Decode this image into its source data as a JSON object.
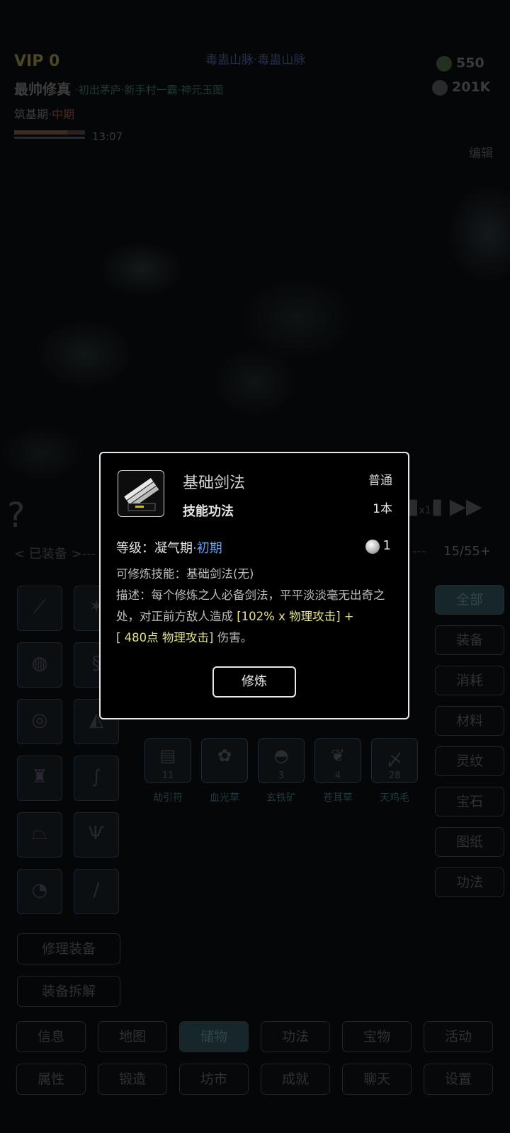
{
  "header": {
    "vip": "VIP 0",
    "location": "毒蛊山脉·毒蛊山脉",
    "player_name": "最帅修真",
    "player_titles": "·初出茅庐·新手村一霸·神元玉图",
    "realm": "筑基期",
    "realm_stage": "·中期",
    "time": "13:07",
    "hp_fraction": 0.75,
    "currency_leaf": "550",
    "currency_stone": "201K",
    "edit": "编辑"
  },
  "battle": {
    "speed_label": "x1"
  },
  "equip_bar": {
    "label": "< 已装备 >---",
    "dashes": "---",
    "count": "15/55+"
  },
  "equipped_slots": [
    {
      "icon": "sword-icon",
      "glyph": "⟋"
    },
    {
      "icon": "claw-icon",
      "glyph": "✶"
    },
    {
      "icon": "hat-icon",
      "glyph": "◍"
    },
    {
      "icon": "dragon-icon",
      "glyph": "§"
    },
    {
      "icon": "jade-pendant-icon",
      "glyph": "◎"
    },
    {
      "icon": "cloak-icon",
      "glyph": "◭"
    },
    {
      "icon": "robe-icon",
      "glyph": "♜"
    },
    {
      "icon": "snake-icon",
      "glyph": "∫"
    },
    {
      "icon": "skirt-icon",
      "glyph": "⏢"
    },
    {
      "icon": "boots-icon",
      "glyph": "Ѱ"
    },
    {
      "icon": "fan-icon",
      "glyph": "◔"
    },
    {
      "icon": "staff-icon",
      "glyph": "∕"
    }
  ],
  "inventory": [
    {
      "name": "劫引符",
      "qty": "11",
      "icon": "talisman-icon",
      "glyph": "▤"
    },
    {
      "name": "血光草",
      "qty": "",
      "icon": "herb-icon",
      "glyph": "✿"
    },
    {
      "name": "玄铁矿",
      "qty": "3",
      "icon": "ore-icon",
      "glyph": "◓"
    },
    {
      "name": "苍耳草",
      "qty": "4",
      "icon": "grass-icon",
      "glyph": "❦"
    },
    {
      "name": "天鸡毛",
      "qty": "28",
      "icon": "feather-icon",
      "glyph": "〆"
    }
  ],
  "categories": [
    "全部",
    "装备",
    "消耗",
    "材料",
    "灵纹",
    "宝石",
    "图纸",
    "功法"
  ],
  "actions": {
    "repair": "修理装备",
    "disassemble": "装备拆解"
  },
  "nav_row1": [
    "信息",
    "地图",
    "储物",
    "功法",
    "宝物",
    "活动"
  ],
  "nav_row2": [
    "属性",
    "锻造",
    "坊市",
    "成就",
    "聊天",
    "设置"
  ],
  "modal": {
    "title": "基础剑法",
    "rarity": "普通",
    "type": "技能功法",
    "quantity": "1本",
    "icon_caption": "一 ·",
    "level_label": "等级：凝气期",
    "level_stage": "·初期",
    "cost": "1",
    "skill_line": "可修炼技能：基础剑法(无)",
    "desc_prefix": "描述：每个修炼之人必备剑法，平平淡淡毫无出奇之处，对正前方敌人造成",
    "desc_hl1": "[102% x 物理攻击]",
    "desc_plus": " +",
    "desc_hl2": "[ 480点 物理攻击]",
    "desc_suffix": " 伤害。",
    "button": "修炼"
  }
}
